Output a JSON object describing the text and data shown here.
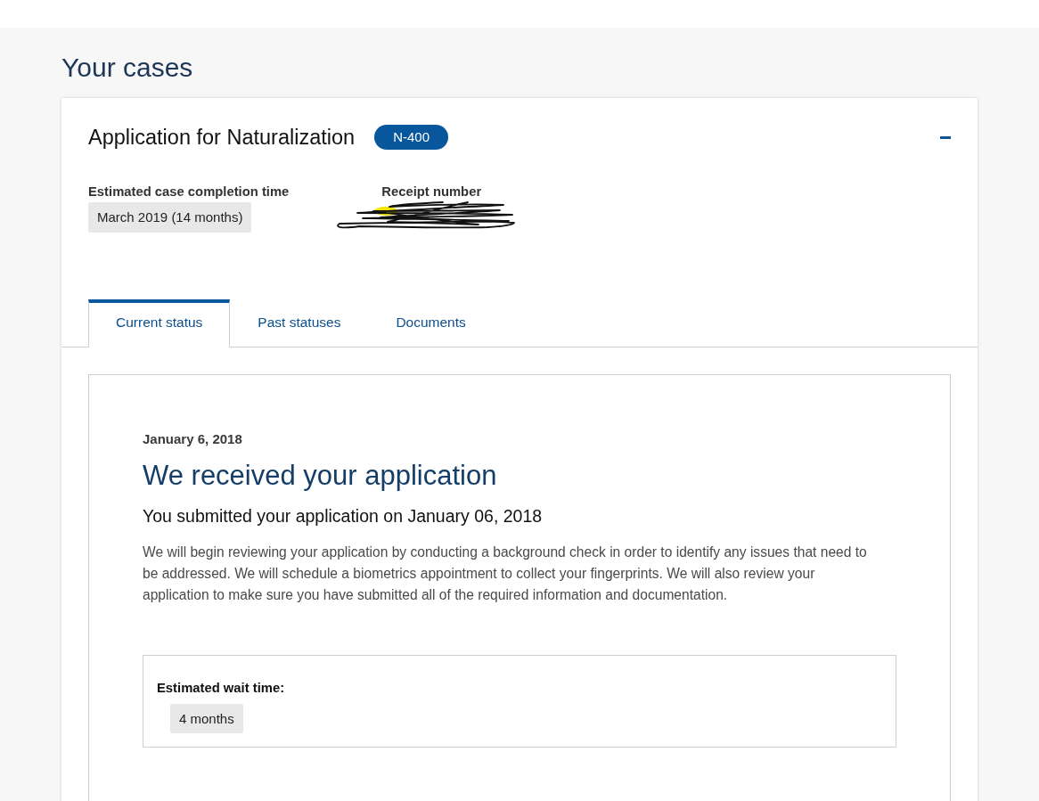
{
  "page": {
    "title": "Your cases"
  },
  "case": {
    "title": "Application for Naturalization",
    "form_badge": "N-400",
    "expanded": true,
    "fields": [
      {
        "label": "Estimated case completion time",
        "value": "March 2019 (14 months)",
        "redacted": false
      },
      {
        "label": "Receipt number",
        "redacted": true
      }
    ],
    "tabs": [
      {
        "label": "Current status",
        "selected": true
      },
      {
        "label": "Past statuses",
        "selected": false
      },
      {
        "label": "Documents",
        "selected": false
      }
    ],
    "status": {
      "date": "January 6, 2018",
      "heading": "We received your application",
      "subheading": "You submitted your application on January 06, 2018",
      "body": "We will begin reviewing your application by conducting a background check in order to identify any issues that need to be addressed. We will schedule a biometrics appointment to collect your fingerprints. We will also review your application to make sure you have submitted all of the required information and documentation.",
      "wait": {
        "label": "Estimated wait time:",
        "value": "4 months"
      }
    }
  }
}
